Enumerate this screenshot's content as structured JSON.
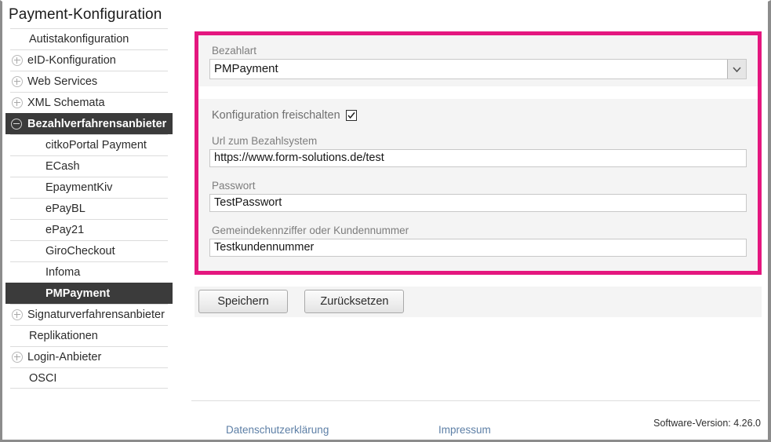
{
  "page": {
    "title": "Payment-Konfiguration"
  },
  "sidebar": {
    "items": [
      {
        "label": "Autistakonfiguration",
        "level": 0,
        "toggle": "none",
        "selected": false
      },
      {
        "label": "eID-Konfiguration",
        "level": 0,
        "toggle": "plus",
        "selected": false
      },
      {
        "label": "Web Services",
        "level": 0,
        "toggle": "plus",
        "selected": false
      },
      {
        "label": "XML Schemata",
        "level": 0,
        "toggle": "plus",
        "selected": false
      },
      {
        "label": "Bezahlverfahrensanbieter",
        "level": 0,
        "toggle": "minus",
        "selected": true
      },
      {
        "label": "citkoPortal Payment",
        "level": 1,
        "toggle": "none",
        "selected": false
      },
      {
        "label": "ECash",
        "level": 1,
        "toggle": "none",
        "selected": false
      },
      {
        "label": "EpaymentKiv",
        "level": 1,
        "toggle": "none",
        "selected": false
      },
      {
        "label": "ePayBL",
        "level": 1,
        "toggle": "none",
        "selected": false
      },
      {
        "label": "ePay21",
        "level": 1,
        "toggle": "none",
        "selected": false
      },
      {
        "label": "GiroCheckout",
        "level": 1,
        "toggle": "none",
        "selected": false
      },
      {
        "label": "Infoma",
        "level": 1,
        "toggle": "none",
        "selected": false
      },
      {
        "label": "PMPayment",
        "level": 1,
        "toggle": "none",
        "selected": true
      },
      {
        "label": "Signaturverfahrensanbieter",
        "level": 0,
        "toggle": "plus",
        "selected": false
      },
      {
        "label": "Replikationen",
        "level": 0,
        "toggle": "none",
        "selected": false
      },
      {
        "label": "Login-Anbieter",
        "level": 0,
        "toggle": "plus",
        "selected": false
      },
      {
        "label": "OSCI",
        "level": 0,
        "toggle": "none",
        "selected": false
      }
    ]
  },
  "form": {
    "highlight_color": "#e4177f",
    "payment_type": {
      "label": "Bezahlart",
      "value": "PMPayment",
      "options": [
        "PMPayment"
      ]
    },
    "enable_config": {
      "label": "Konfiguration freischalten",
      "checked": true
    },
    "url": {
      "label": "Url zum Bezahlsystem",
      "value": "https://www.form-solutions.de/test",
      "placeholder": ""
    },
    "password": {
      "label": "Passwort",
      "value": "TestPasswort",
      "placeholder": ""
    },
    "customer_number": {
      "label": "Gemeindekennziffer oder Kundennummer",
      "value": "Testkundennummer",
      "placeholder": ""
    }
  },
  "buttons": {
    "save": "Speichern",
    "reset": "Zurücksetzen"
  },
  "footer": {
    "privacy_link": "Datenschutzerklärung",
    "imprint_link": "Impressum",
    "version": "Software-Version: 4.26.0"
  }
}
